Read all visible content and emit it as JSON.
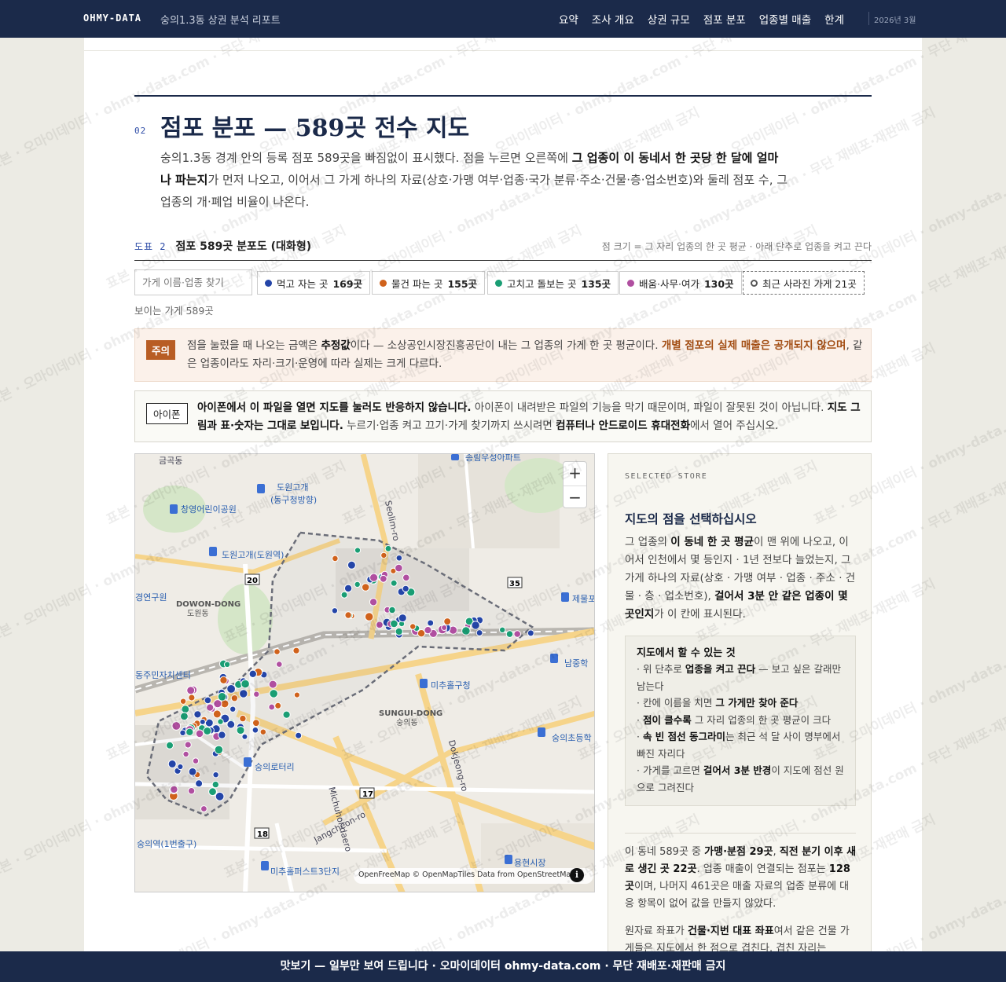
{
  "nav": {
    "brand": "OHMY-DATA",
    "report_title": "숭의1.3동 상권 분석 리포트",
    "items": [
      "요약",
      "조사 개요",
      "상권 규모",
      "점포 분포",
      "업종별 매출",
      "한계"
    ],
    "date": "2026년 3월"
  },
  "section": {
    "number": "02",
    "title": "점포 분포 — 589곳 전수 지도",
    "lead_1": "숭의1.3동 경계 안의 등록 점포 589곳을 빠짐없이 표시했다. 점을 누르면 오른쪽에 ",
    "lead_b1": "그 업종이 이 동네서 한 곳당 한 달에 얼마나 파는지",
    "lead_2": "가 먼저 나오고, 이어서 그 가게 하나의 자료(상호·가맹 여부·업종·국가 분류·주소·건물·층·업소번호)와 둘레 점포 수, 그 업종의 개·폐업 비율이 나온다."
  },
  "figure": {
    "number": "도표 2",
    "title": "점포 589곳 분포도 (대화형)",
    "note": "점 크기 = 그 자리 업종의 한 곳 평균 · 아래 단추로 업종을 켜고 끈다"
  },
  "filters": {
    "search_placeholder": "가게 이름·업종 찾기",
    "chips": [
      {
        "label": "먹고 자는 곳",
        "count": "169곳",
        "color": "#2445a8"
      },
      {
        "label": "물건 파는 곳",
        "count": "155곳",
        "color": "#d0621c"
      },
      {
        "label": "고치고 돌보는 곳",
        "count": "135곳",
        "color": "#1a9e74"
      },
      {
        "label": "배움·사무·여가",
        "count": "130곳",
        "color": "#b04fa0"
      }
    ],
    "closed_chip": "최근 사라진 가게 21곳",
    "visible_count": "보이는 가게 589곳"
  },
  "caution": {
    "tag": "주의",
    "t1": "점을 눌렀을 때 나오는 금액은 ",
    "b1": "추정값",
    "t2": "이다 — 소상공인시장진흥공단이 내는 그 업종의 가게 한 곳 평균이다. ",
    "w1": "개별 점포의 실제 매출은 공개되지 않으며",
    "t3": ", 같은 업종이라도 자리·크기·운영에 따라 실제는 크게 다르다."
  },
  "iphone": {
    "tag": "아이폰",
    "b1": "아이폰에서 이 파일을 열면 지도를 눌러도 반응하지 않습니다.",
    "t1": " 아이폰이 내려받은 파일의 기능을 막기 때문이며, 파일이 잘못된 것이 아닙니다. ",
    "b2": "지도 그림과 표·숫자는 그대로 보입니다.",
    "t2": " 누르기·업종 켜고 끄기·가게 찾기까지 쓰시려면 ",
    "b3": "컴퓨터나 안드로이드 휴대전화",
    "t3": "에서 열어 주십시오."
  },
  "map": {
    "labels": {
      "l1": "금곡동",
      "l2": "도원고개",
      "l3": "(동구청방향)",
      "l4": "창영어린이공원",
      "l5": "도원고개(도원역)",
      "l6": "송림우성아파트",
      "l7": "제물포",
      "l8": "DOWON-DONG",
      "l9": "도원동",
      "l10": "동주민자치센터",
      "l11": "미추홀구청",
      "l12": "SUNGUI-DONG",
      "l13": "숭의동",
      "l14": "남중학",
      "l15": "숭의초등학",
      "l16": "숭의로터리",
      "l17": "숭의역(1번출구)",
      "l18": "미추홀퍼스트3단지",
      "l19": "용현시장",
      "l20": "경연구원",
      "l21": "Michuhol-daero",
      "l22": "Dokjeong-ro",
      "l23": "Jangcheon-ro",
      "l24": "Seolim-ro"
    },
    "route_numbers": [
      "20",
      "35",
      "17",
      "18"
    ],
    "zoom_in": "+",
    "zoom_out": "−",
    "attribution": "OpenFreeMap © OpenMapTiles Data from OpenStreetMap",
    "info": "i"
  },
  "panel": {
    "eyebrow": "SELECTED STORE",
    "title": "지도의 점을 선택하십시오",
    "d1": "그 업종의 ",
    "db1": "이 동네 한 곳 평균",
    "d2": "이 맨 위에 나오고, 이어서 인천에서 몇 등인지 · 1년 전보다 늘었는지, 그 가게 하나의 자료(상호 · 가맹 여부 · 업종 · 주소 · 건물 · 층 · 업소번호), ",
    "db2": "걸어서 3분 안 같은 업종이 몇 곳인지",
    "d3": "가 이 칸에 표시된다.",
    "help_title": "지도에서 할 수 있는 것",
    "help": [
      {
        "pre": "· 위 단추로 ",
        "b": "업종을 켜고 끈다",
        "post": " — 보고 싶은 갈래만 남는다"
      },
      {
        "pre": "· 칸에 이름을 치면 ",
        "b": "그 가게만 찾아 준다",
        "post": ""
      },
      {
        "pre": "· ",
        "b": "점이 클수록",
        "post": " 그 자리 업종의 한 곳 평균이 크다"
      },
      {
        "pre": "· ",
        "b": "속 빈 점선 동그라미",
        "post": "는 최근 석 달 사이 명부에서 빠진 자리다"
      },
      {
        "pre": "· 가게를 고르면 ",
        "b": "걸어서 3분 반경",
        "post": "이 지도에 점선 원으로 그려진다"
      }
    ],
    "s1": "이 동네 589곳 중 ",
    "sb1": "가맹·분점 29곳",
    "s2": ", ",
    "sb2": "직전 분기 이후 새로 생긴 곳 22곳",
    "s3": ". 업종 매출이 연결되는 점포는 ",
    "sb3": "128곳",
    "s4": "이며, 나머지 461곳은 매출 자료의 업종 분류에 대응 항목이 없어 값을 만들지 않았다.",
    "c1": "원자료 좌표가 ",
    "cb1": "건물·지번 대표 좌표",
    "c2": "여서 같은 건물 가게들은 지도에서 한 점으로 겹친다. 겹친 자리는"
  },
  "footer": "맛보기 — 일부만 보여 드립니다 · 오마이데이터 ohmy-data.com · 무단 재배포·재판매 금지",
  "watermark": "표본 · 오마이데이터 · ohmy-data.com · 무단 재배포·재판매 금지"
}
